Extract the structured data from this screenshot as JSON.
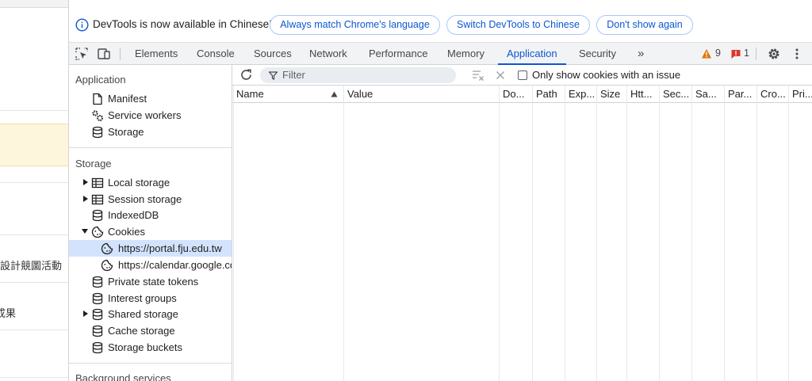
{
  "page_left": {
    "text_a": "設計競圖活動",
    "text_b": "成果"
  },
  "infobar": {
    "message": "DevTools is now available in Chinese!",
    "btn_match": "Always match Chrome's language",
    "btn_switch": "Switch DevTools to Chinese",
    "btn_dismiss": "Don't show again"
  },
  "tabs": {
    "elements": "Elements",
    "console": "Console",
    "sources": "Sources",
    "network": "Network",
    "performance": "Performance",
    "memory": "Memory",
    "application": "Application",
    "security": "Security",
    "more": "»",
    "warnings_count": "9",
    "errors_count": "1"
  },
  "sidebar": {
    "application_header": "Application",
    "manifest": "Manifest",
    "service_workers": "Service workers",
    "storage_overview": "Storage",
    "storage_header": "Storage",
    "local_storage": "Local storage",
    "session_storage": "Session storage",
    "indexeddb": "IndexedDB",
    "cookies": "Cookies",
    "cookie_site_1": "https://portal.fju.edu.tw",
    "cookie_site_2": "https://calendar.google.com",
    "private_state_tokens": "Private state tokens",
    "interest_groups": "Interest groups",
    "shared_storage": "Shared storage",
    "cache_storage": "Cache storage",
    "storage_buckets": "Storage buckets",
    "background_header": "Background services"
  },
  "cookie_toolbar": {
    "filter_placeholder": "Filter",
    "only_issues_label": "Only show cookies with an issue"
  },
  "columns": {
    "name": "Name",
    "value": "Value",
    "domain": "Do...",
    "path": "Path",
    "expires": "Exp...",
    "size": "Size",
    "httponly": "Htt...",
    "secure": "Sec...",
    "samesite": "Sa...",
    "partition": "Par...",
    "crosssite": "Cro...",
    "priority": "Pri..."
  },
  "colors": {
    "accent": "#0b57d0",
    "selected_bg": "#d3e3fd",
    "warning": "#e37400",
    "error": "#dc362e"
  }
}
